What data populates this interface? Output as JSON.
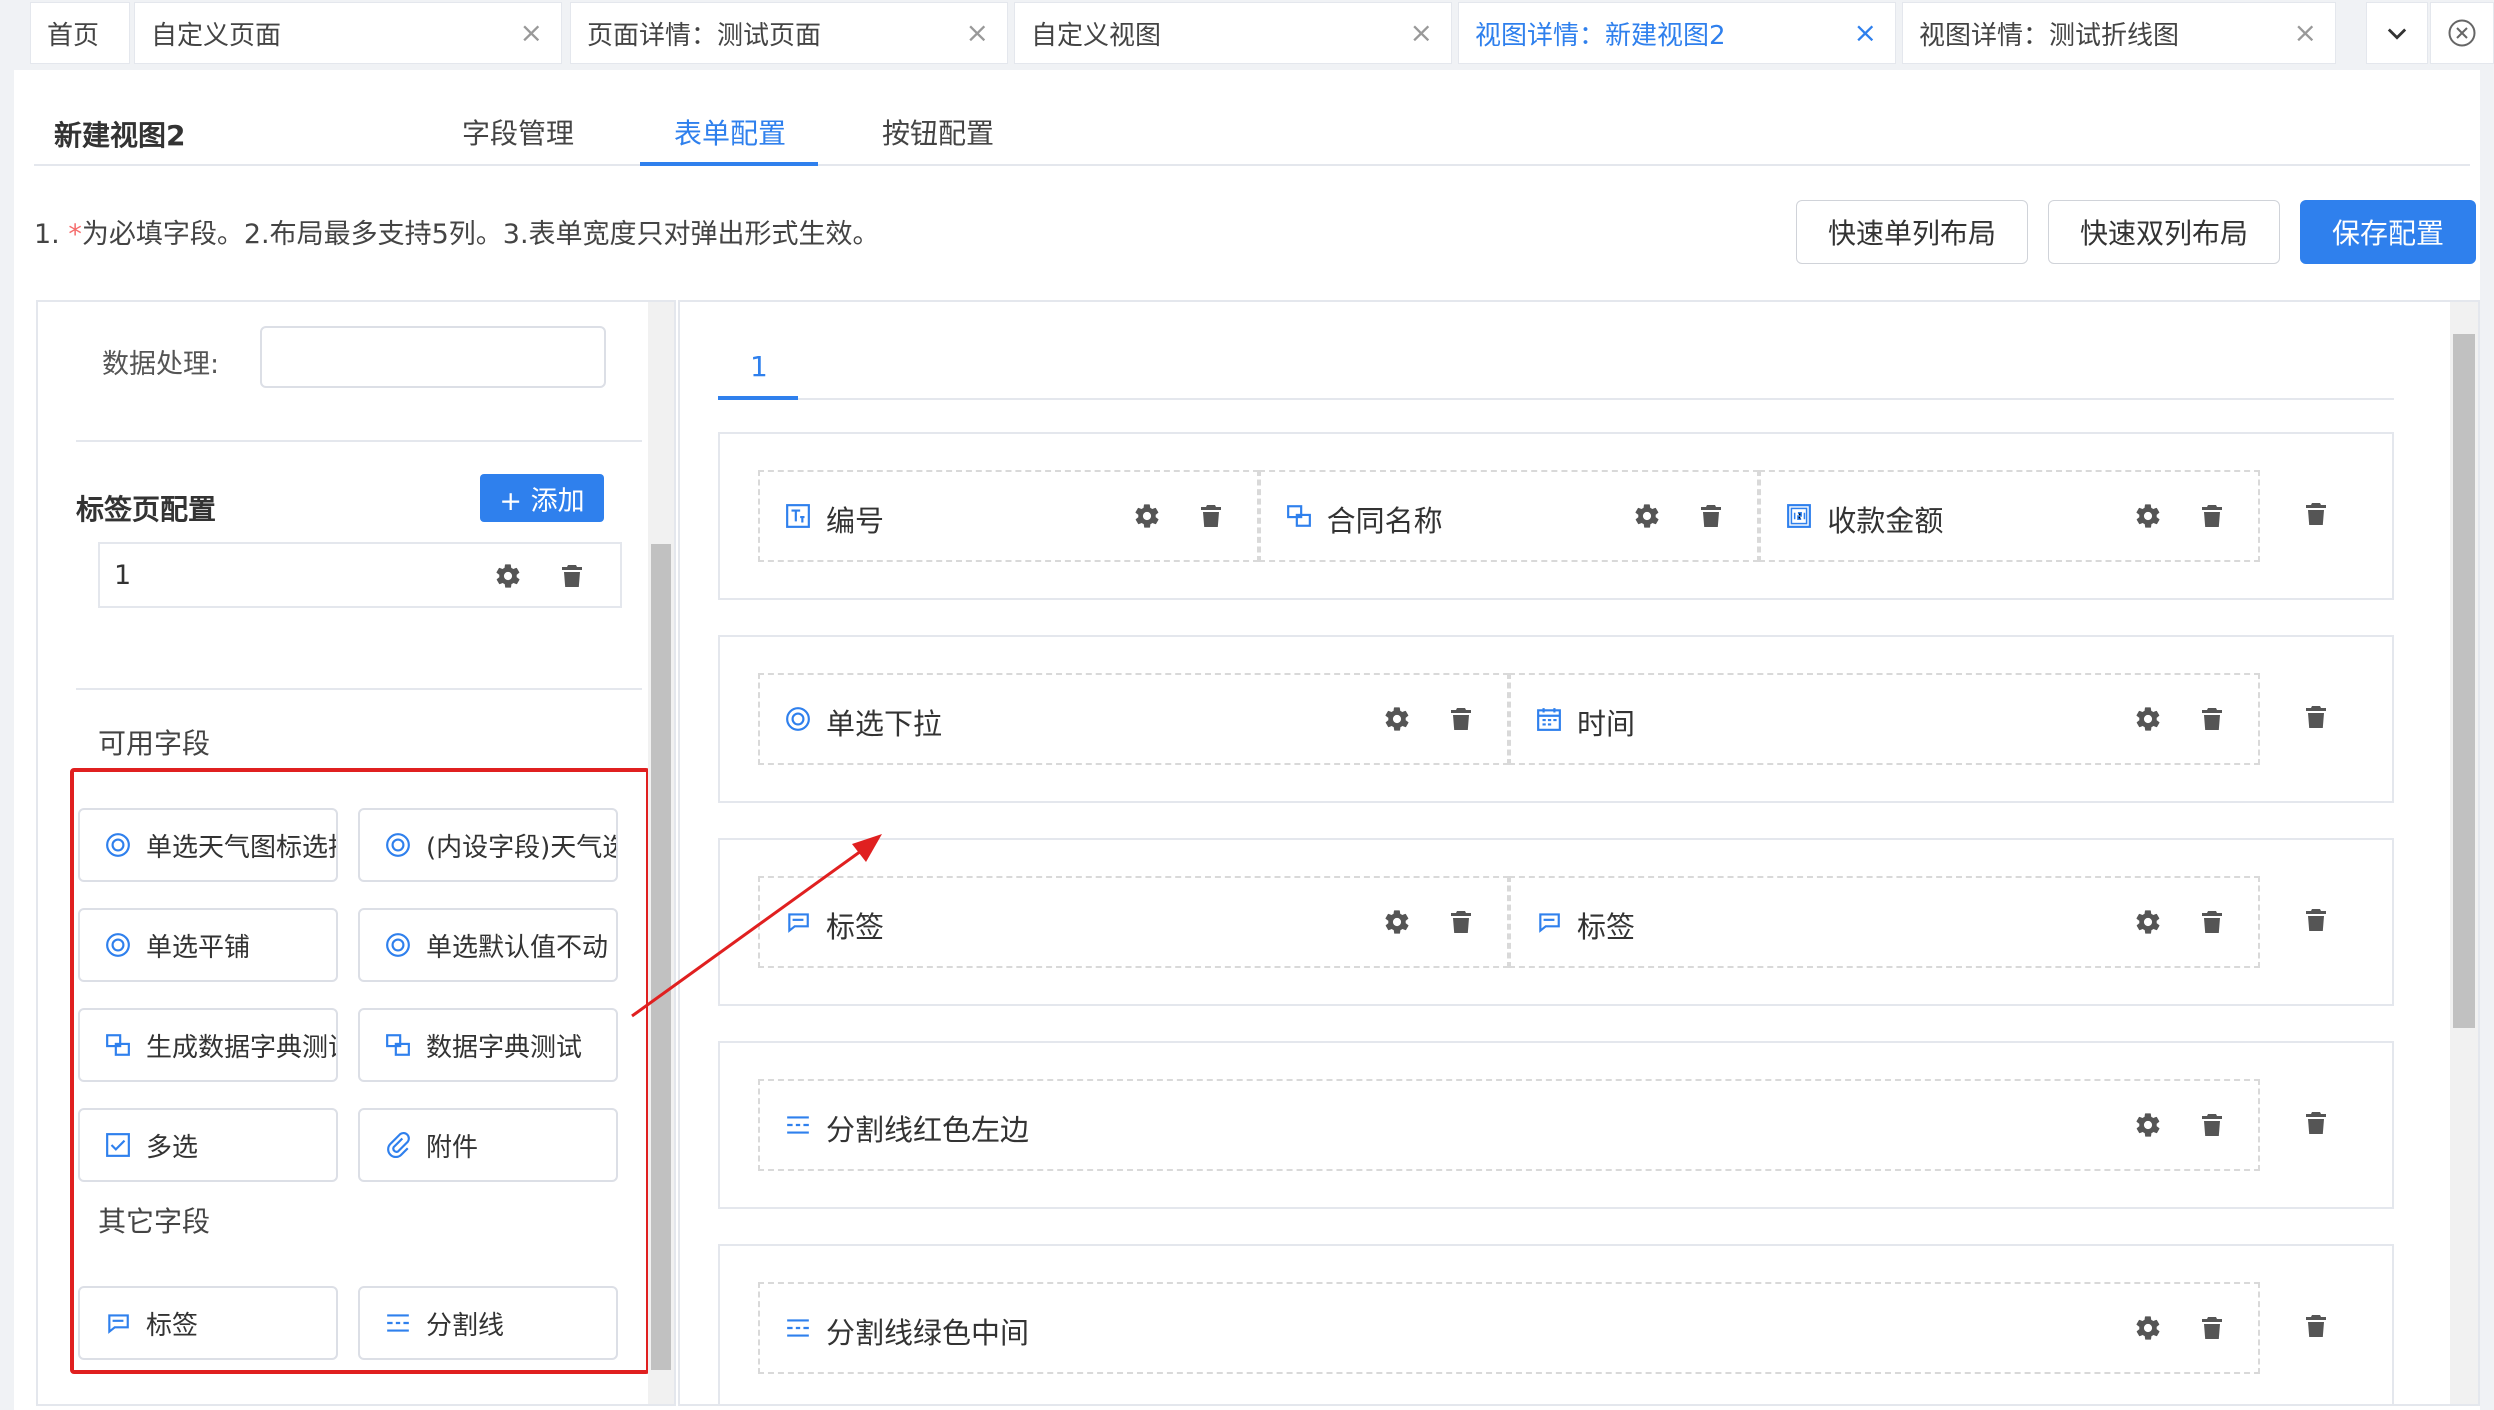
{
  "tabs": [
    {
      "label": "首页",
      "closable": false,
      "active": false
    },
    {
      "label": "自定义页面",
      "closable": true,
      "active": false
    },
    {
      "label": "页面详情：测试页面",
      "closable": true,
      "active": false
    },
    {
      "label": "自定义视图",
      "closable": true,
      "active": false
    },
    {
      "label": "视图详情：新建视图2",
      "closable": true,
      "active": true
    },
    {
      "label": "视图详情：测试折线图",
      "closable": true,
      "active": false
    }
  ],
  "close_glyph": "×",
  "view_title": "新建视图2",
  "subtabs": [
    "字段管理",
    "表单配置",
    "按钮配置"
  ],
  "active_subtab": "表单配置",
  "hint": {
    "prefix": "1. ",
    "required_mark": "*",
    "text": "为必填字段。2.布局最多支持5列。3.表单宽度只对弹出形式生效。"
  },
  "buttons": {
    "single": "快速单列布局",
    "double": "快速双列布局",
    "save": "保存配置"
  },
  "left": {
    "data_processing_label": "数据处理:",
    "data_processing_value": "",
    "tab_config_title": "标签页配置",
    "add_button": "+ 添加",
    "tab_items": [
      "1"
    ],
    "available_title": "可用字段",
    "available_fields": [
      {
        "label": "单选天气图标选择",
        "icon": "radio-icon"
      },
      {
        "label": "(内设字段)天气选择",
        "icon": "radio-icon"
      },
      {
        "label": "单选平铺",
        "icon": "radio-icon"
      },
      {
        "label": "单选默认值不动",
        "icon": "radio-icon"
      },
      {
        "label": "生成数据字典测试",
        "icon": "dict-icon"
      },
      {
        "label": "数据字典测试",
        "icon": "dict-icon"
      },
      {
        "label": "多选",
        "icon": "checkbox-icon"
      },
      {
        "label": "附件",
        "icon": "paperclip-icon"
      }
    ],
    "other_title": "其它字段",
    "other_fields": [
      {
        "label": "标签",
        "icon": "label-icon"
      },
      {
        "label": "分割线",
        "icon": "divider-icon"
      }
    ]
  },
  "right": {
    "form_tab": "1",
    "rows": [
      {
        "cells": [
          {
            "label": "编号",
            "icon": "text-field-icon"
          },
          {
            "label": "合同名称",
            "icon": "dict-icon"
          },
          {
            "label": "收款金额",
            "icon": "number-icon"
          }
        ]
      },
      {
        "cells": [
          {
            "label": "单选下拉",
            "icon": "radio-icon"
          },
          {
            "label": "时间",
            "icon": "calendar-icon"
          }
        ]
      },
      {
        "cells": [
          {
            "label": "标签",
            "icon": "label-icon"
          },
          {
            "label": "标签",
            "icon": "label-icon"
          }
        ]
      },
      {
        "cells": [
          {
            "label": "分割线红色左边",
            "icon": "divider-icon"
          }
        ]
      },
      {
        "cells": [
          {
            "label": "分割线绿色中间",
            "icon": "divider-icon"
          }
        ]
      }
    ]
  },
  "colors": {
    "primary": "#2f80ed",
    "annotation": "#e02020",
    "required": "#f56c6c"
  }
}
